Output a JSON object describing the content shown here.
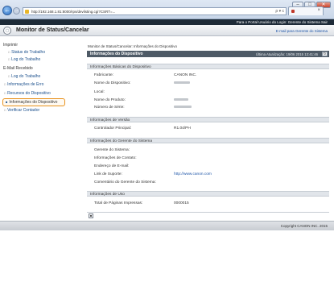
{
  "browser": {
    "url": "http://192.168.1.81:8000/rps/devlisting.cgi?CSRT=...",
    "controls": {
      "minimize": "–",
      "maximize": "□",
      "close": "✕"
    },
    "address_buttons": "ρ ▾ c",
    "tab_close": "×"
  },
  "topbar": {
    "links": "Para o Portal   Usuário do Login: Gerente do Sistema Sair"
  },
  "header": {
    "title": "Monitor de Status/Cancelar",
    "manager_link": "E-mail para Gerente do Sistema"
  },
  "sidebar": {
    "items": [
      {
        "label": "Imprimir"
      },
      {
        "label": "Status do Trabalho"
      },
      {
        "label": "Log do Trabalho"
      },
      {
        "label": "E-Mail Recebido"
      },
      {
        "label": "Log do Trabalho"
      },
      {
        "label": "Informações de Erro"
      },
      {
        "label": "Recursos do Dispositivo"
      },
      {
        "label": "Informações do Dispositivo"
      },
      {
        "label": "Verificar Contador"
      }
    ]
  },
  "main": {
    "breadcrumb": "Monitor de Status/Cancelar: Informações do Dispositivo",
    "panel_title": "Informações do Dispositivo",
    "last_update": "Última Atualização: 19/06 2015 13:41:46",
    "refresh_icon": "refresh-icon",
    "sections": {
      "basic": {
        "title": "Informações Básicas do Dispositivo",
        "rows": [
          {
            "label": "Fabricante:",
            "value": "CANON INC."
          },
          {
            "label": "Nome do Dispositivo:",
            "value": ""
          },
          {
            "label": "Local:",
            "value": ""
          },
          {
            "label": "Nome do Produto:",
            "value": ""
          },
          {
            "label": "Número de Série:",
            "value": ""
          }
        ]
      },
      "version": {
        "title": "Informações de Versão",
        "rows": [
          {
            "label": "Controlador Principal:",
            "value": "R1.04/PH"
          }
        ]
      },
      "manager": {
        "title": "Informações do Gerente do Sistema",
        "rows": [
          {
            "label": "Gerente do Sistema:",
            "value": ""
          },
          {
            "label": "Informações de Contato:",
            "value": ""
          },
          {
            "label": "Endereço de E-mail:",
            "value": ""
          },
          {
            "label": "Link de Suporte:",
            "value": "http://www.canon.com"
          },
          {
            "label": "Comentário do Gerente do Sistema:",
            "value": ""
          }
        ]
      },
      "usage": {
        "title": "Informações de Uso",
        "rows": [
          {
            "label": "Total de Páginas Impressas:",
            "value": "0000015"
          }
        ]
      }
    }
  },
  "footer": {
    "copyright": "Copyright CANON INC. 2015"
  }
}
